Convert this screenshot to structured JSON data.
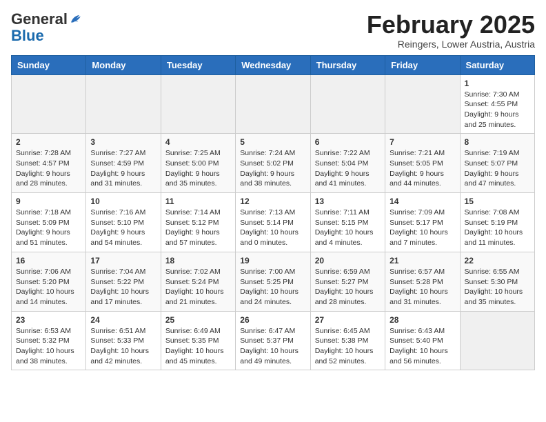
{
  "header": {
    "logo_general": "General",
    "logo_blue": "Blue",
    "month_title": "February 2025",
    "subtitle": "Reingers, Lower Austria, Austria"
  },
  "weekdays": [
    "Sunday",
    "Monday",
    "Tuesday",
    "Wednesday",
    "Thursday",
    "Friday",
    "Saturday"
  ],
  "weeks": [
    [
      {
        "day": "",
        "info": ""
      },
      {
        "day": "",
        "info": ""
      },
      {
        "day": "",
        "info": ""
      },
      {
        "day": "",
        "info": ""
      },
      {
        "day": "",
        "info": ""
      },
      {
        "day": "",
        "info": ""
      },
      {
        "day": "1",
        "info": "Sunrise: 7:30 AM\nSunset: 4:55 PM\nDaylight: 9 hours and 25 minutes."
      }
    ],
    [
      {
        "day": "2",
        "info": "Sunrise: 7:28 AM\nSunset: 4:57 PM\nDaylight: 9 hours and 28 minutes."
      },
      {
        "day": "3",
        "info": "Sunrise: 7:27 AM\nSunset: 4:59 PM\nDaylight: 9 hours and 31 minutes."
      },
      {
        "day": "4",
        "info": "Sunrise: 7:25 AM\nSunset: 5:00 PM\nDaylight: 9 hours and 35 minutes."
      },
      {
        "day": "5",
        "info": "Sunrise: 7:24 AM\nSunset: 5:02 PM\nDaylight: 9 hours and 38 minutes."
      },
      {
        "day": "6",
        "info": "Sunrise: 7:22 AM\nSunset: 5:04 PM\nDaylight: 9 hours and 41 minutes."
      },
      {
        "day": "7",
        "info": "Sunrise: 7:21 AM\nSunset: 5:05 PM\nDaylight: 9 hours and 44 minutes."
      },
      {
        "day": "8",
        "info": "Sunrise: 7:19 AM\nSunset: 5:07 PM\nDaylight: 9 hours and 47 minutes."
      }
    ],
    [
      {
        "day": "9",
        "info": "Sunrise: 7:18 AM\nSunset: 5:09 PM\nDaylight: 9 hours and 51 minutes."
      },
      {
        "day": "10",
        "info": "Sunrise: 7:16 AM\nSunset: 5:10 PM\nDaylight: 9 hours and 54 minutes."
      },
      {
        "day": "11",
        "info": "Sunrise: 7:14 AM\nSunset: 5:12 PM\nDaylight: 9 hours and 57 minutes."
      },
      {
        "day": "12",
        "info": "Sunrise: 7:13 AM\nSunset: 5:14 PM\nDaylight: 10 hours and 0 minutes."
      },
      {
        "day": "13",
        "info": "Sunrise: 7:11 AM\nSunset: 5:15 PM\nDaylight: 10 hours and 4 minutes."
      },
      {
        "day": "14",
        "info": "Sunrise: 7:09 AM\nSunset: 5:17 PM\nDaylight: 10 hours and 7 minutes."
      },
      {
        "day": "15",
        "info": "Sunrise: 7:08 AM\nSunset: 5:19 PM\nDaylight: 10 hours and 11 minutes."
      }
    ],
    [
      {
        "day": "16",
        "info": "Sunrise: 7:06 AM\nSunset: 5:20 PM\nDaylight: 10 hours and 14 minutes."
      },
      {
        "day": "17",
        "info": "Sunrise: 7:04 AM\nSunset: 5:22 PM\nDaylight: 10 hours and 17 minutes."
      },
      {
        "day": "18",
        "info": "Sunrise: 7:02 AM\nSunset: 5:24 PM\nDaylight: 10 hours and 21 minutes."
      },
      {
        "day": "19",
        "info": "Sunrise: 7:00 AM\nSunset: 5:25 PM\nDaylight: 10 hours and 24 minutes."
      },
      {
        "day": "20",
        "info": "Sunrise: 6:59 AM\nSunset: 5:27 PM\nDaylight: 10 hours and 28 minutes."
      },
      {
        "day": "21",
        "info": "Sunrise: 6:57 AM\nSunset: 5:28 PM\nDaylight: 10 hours and 31 minutes."
      },
      {
        "day": "22",
        "info": "Sunrise: 6:55 AM\nSunset: 5:30 PM\nDaylight: 10 hours and 35 minutes."
      }
    ],
    [
      {
        "day": "23",
        "info": "Sunrise: 6:53 AM\nSunset: 5:32 PM\nDaylight: 10 hours and 38 minutes."
      },
      {
        "day": "24",
        "info": "Sunrise: 6:51 AM\nSunset: 5:33 PM\nDaylight: 10 hours and 42 minutes."
      },
      {
        "day": "25",
        "info": "Sunrise: 6:49 AM\nSunset: 5:35 PM\nDaylight: 10 hours and 45 minutes."
      },
      {
        "day": "26",
        "info": "Sunrise: 6:47 AM\nSunset: 5:37 PM\nDaylight: 10 hours and 49 minutes."
      },
      {
        "day": "27",
        "info": "Sunrise: 6:45 AM\nSunset: 5:38 PM\nDaylight: 10 hours and 52 minutes."
      },
      {
        "day": "28",
        "info": "Sunrise: 6:43 AM\nSunset: 5:40 PM\nDaylight: 10 hours and 56 minutes."
      },
      {
        "day": "",
        "info": ""
      }
    ]
  ]
}
